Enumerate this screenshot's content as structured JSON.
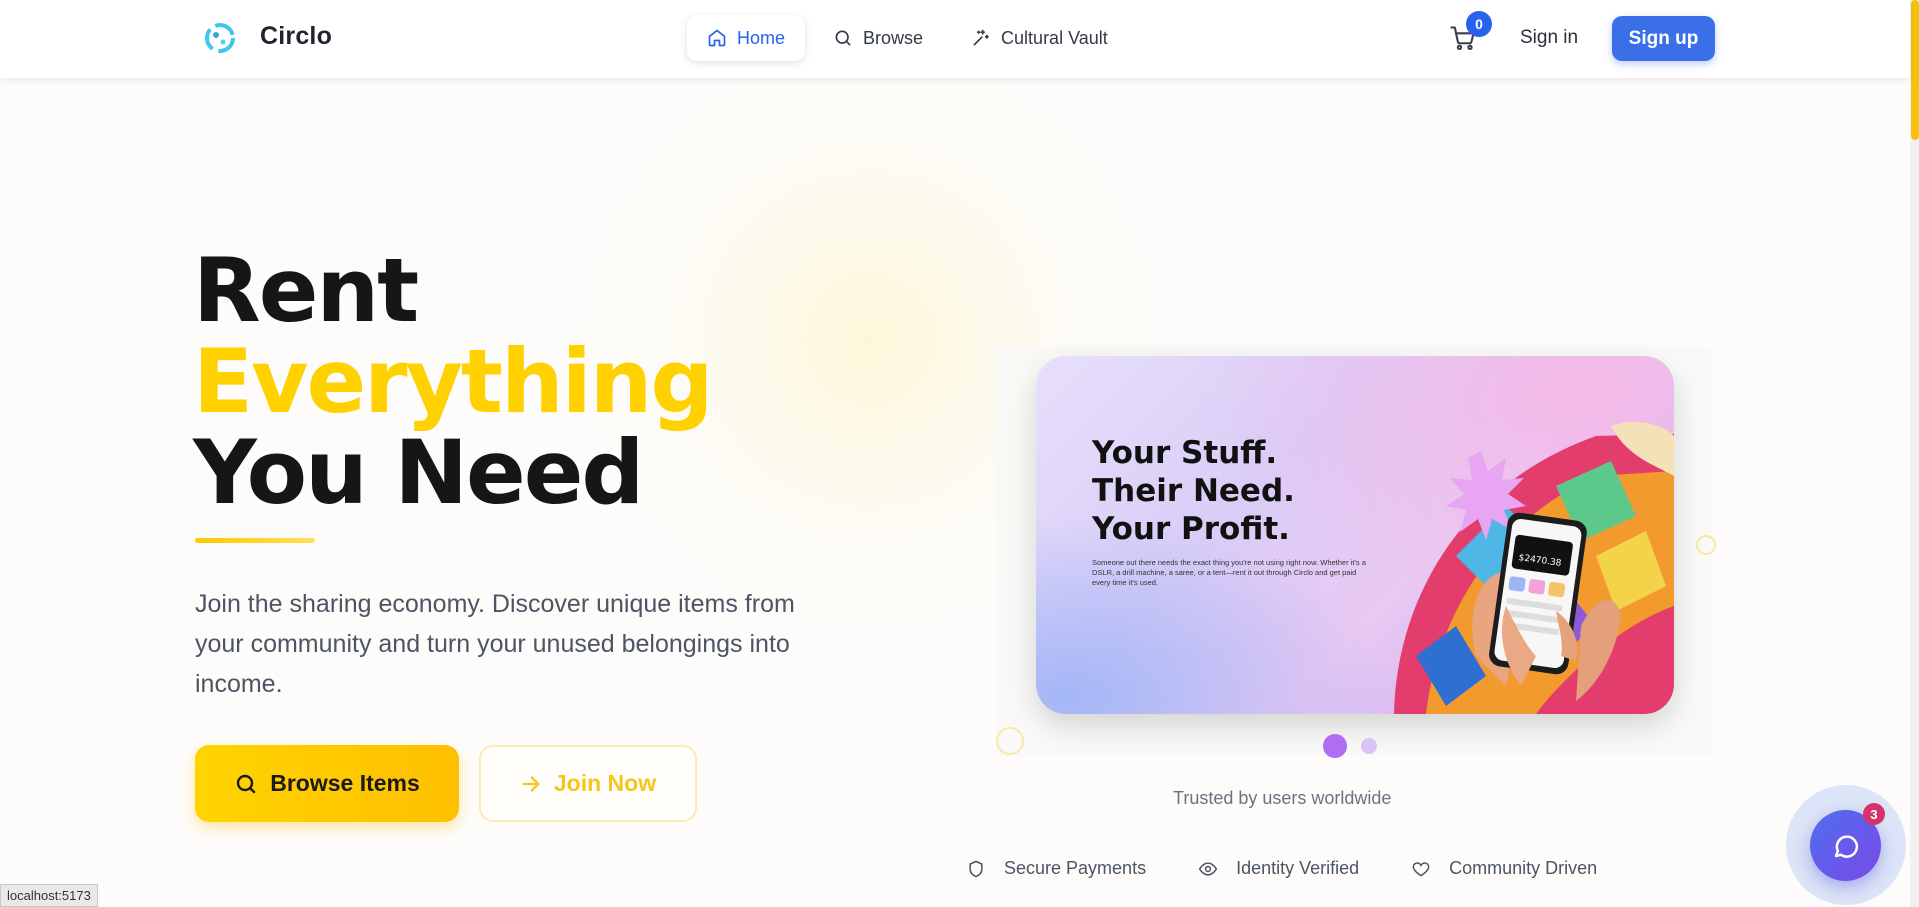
{
  "header": {
    "brand": "Circlo",
    "nav": [
      {
        "label": "Home",
        "icon": "home-icon",
        "active": true
      },
      {
        "label": "Browse",
        "icon": "search-icon",
        "active": false
      },
      {
        "label": "Cultural Vault",
        "icon": "sparkles-icon",
        "active": false
      }
    ],
    "cart_count": "0",
    "signin_label": "Sign in",
    "signup_label": "Sign up"
  },
  "hero": {
    "title_line1": "Rent",
    "title_line2": "Everything",
    "title_line3": "You Need",
    "subtitle": "Join the sharing economy. Discover unique items from your community and turn your unused belongings into income.",
    "browse_label": "Browse Items",
    "join_label": "Join Now"
  },
  "banner": {
    "headline_1": "Your Stuff.",
    "headline_2": "Their Need.",
    "headline_3": "Your Profit.",
    "body": "Someone out there needs the exact thing you're not using right now. Whether it's a DSLR, a drill machine, a saree, or a tent—rent it out through Circlo and get paid every time it's used.",
    "phone_amount": "$2470.38",
    "slides_total": 2,
    "active_slide": 1
  },
  "trust": {
    "heading": "Trusted by users worldwide",
    "items": [
      {
        "label": "Secure Payments",
        "icon": "shield-icon"
      },
      {
        "label": "Identity Verified",
        "icon": "eye-icon"
      },
      {
        "label": "Community Driven",
        "icon": "heart-icon"
      }
    ]
  },
  "chat": {
    "badge": "3"
  },
  "status_bar": {
    "url": "localhost:5173"
  },
  "colors": {
    "accent": "#ffd100",
    "primary": "#3b6fe8",
    "purple": "#b06cf2"
  }
}
